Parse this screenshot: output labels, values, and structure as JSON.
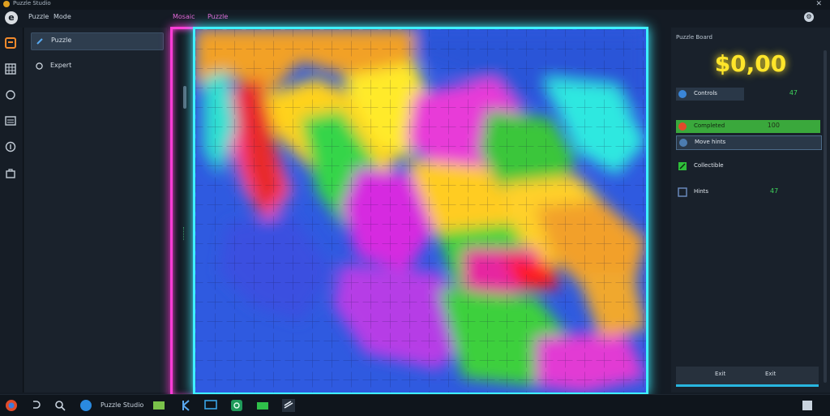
{
  "window": {
    "title": "Puzzle Studio"
  },
  "menu": {
    "items": [
      "Puzzle",
      "Mode"
    ],
    "breadcrumb": [
      "Mosaic",
      "Puzzle"
    ]
  },
  "sidebar": {
    "items": [
      {
        "label": "Puzzle",
        "active": true
      },
      {
        "label": "Expert",
        "active": false
      }
    ]
  },
  "score_panel": {
    "title": "Puzzle Board",
    "score": "$0,00",
    "stats": [
      {
        "label": "Controls",
        "value": "47"
      },
      {
        "label": "Completed",
        "value": "100"
      },
      {
        "label": "Move hints",
        "value": ""
      },
      {
        "label": "Collectible",
        "value": ""
      },
      {
        "label": "Hints",
        "value": "47"
      }
    ],
    "buttons": [
      "Exit",
      "Exit"
    ]
  },
  "taskbar": {
    "active_label": "Puzzle Studio"
  },
  "colors": {
    "score": "#ffe52a",
    "cyan_glow": "#3ff0ff",
    "pink_glow": "#ff3dd8",
    "accent_green": "#3fd45c"
  }
}
